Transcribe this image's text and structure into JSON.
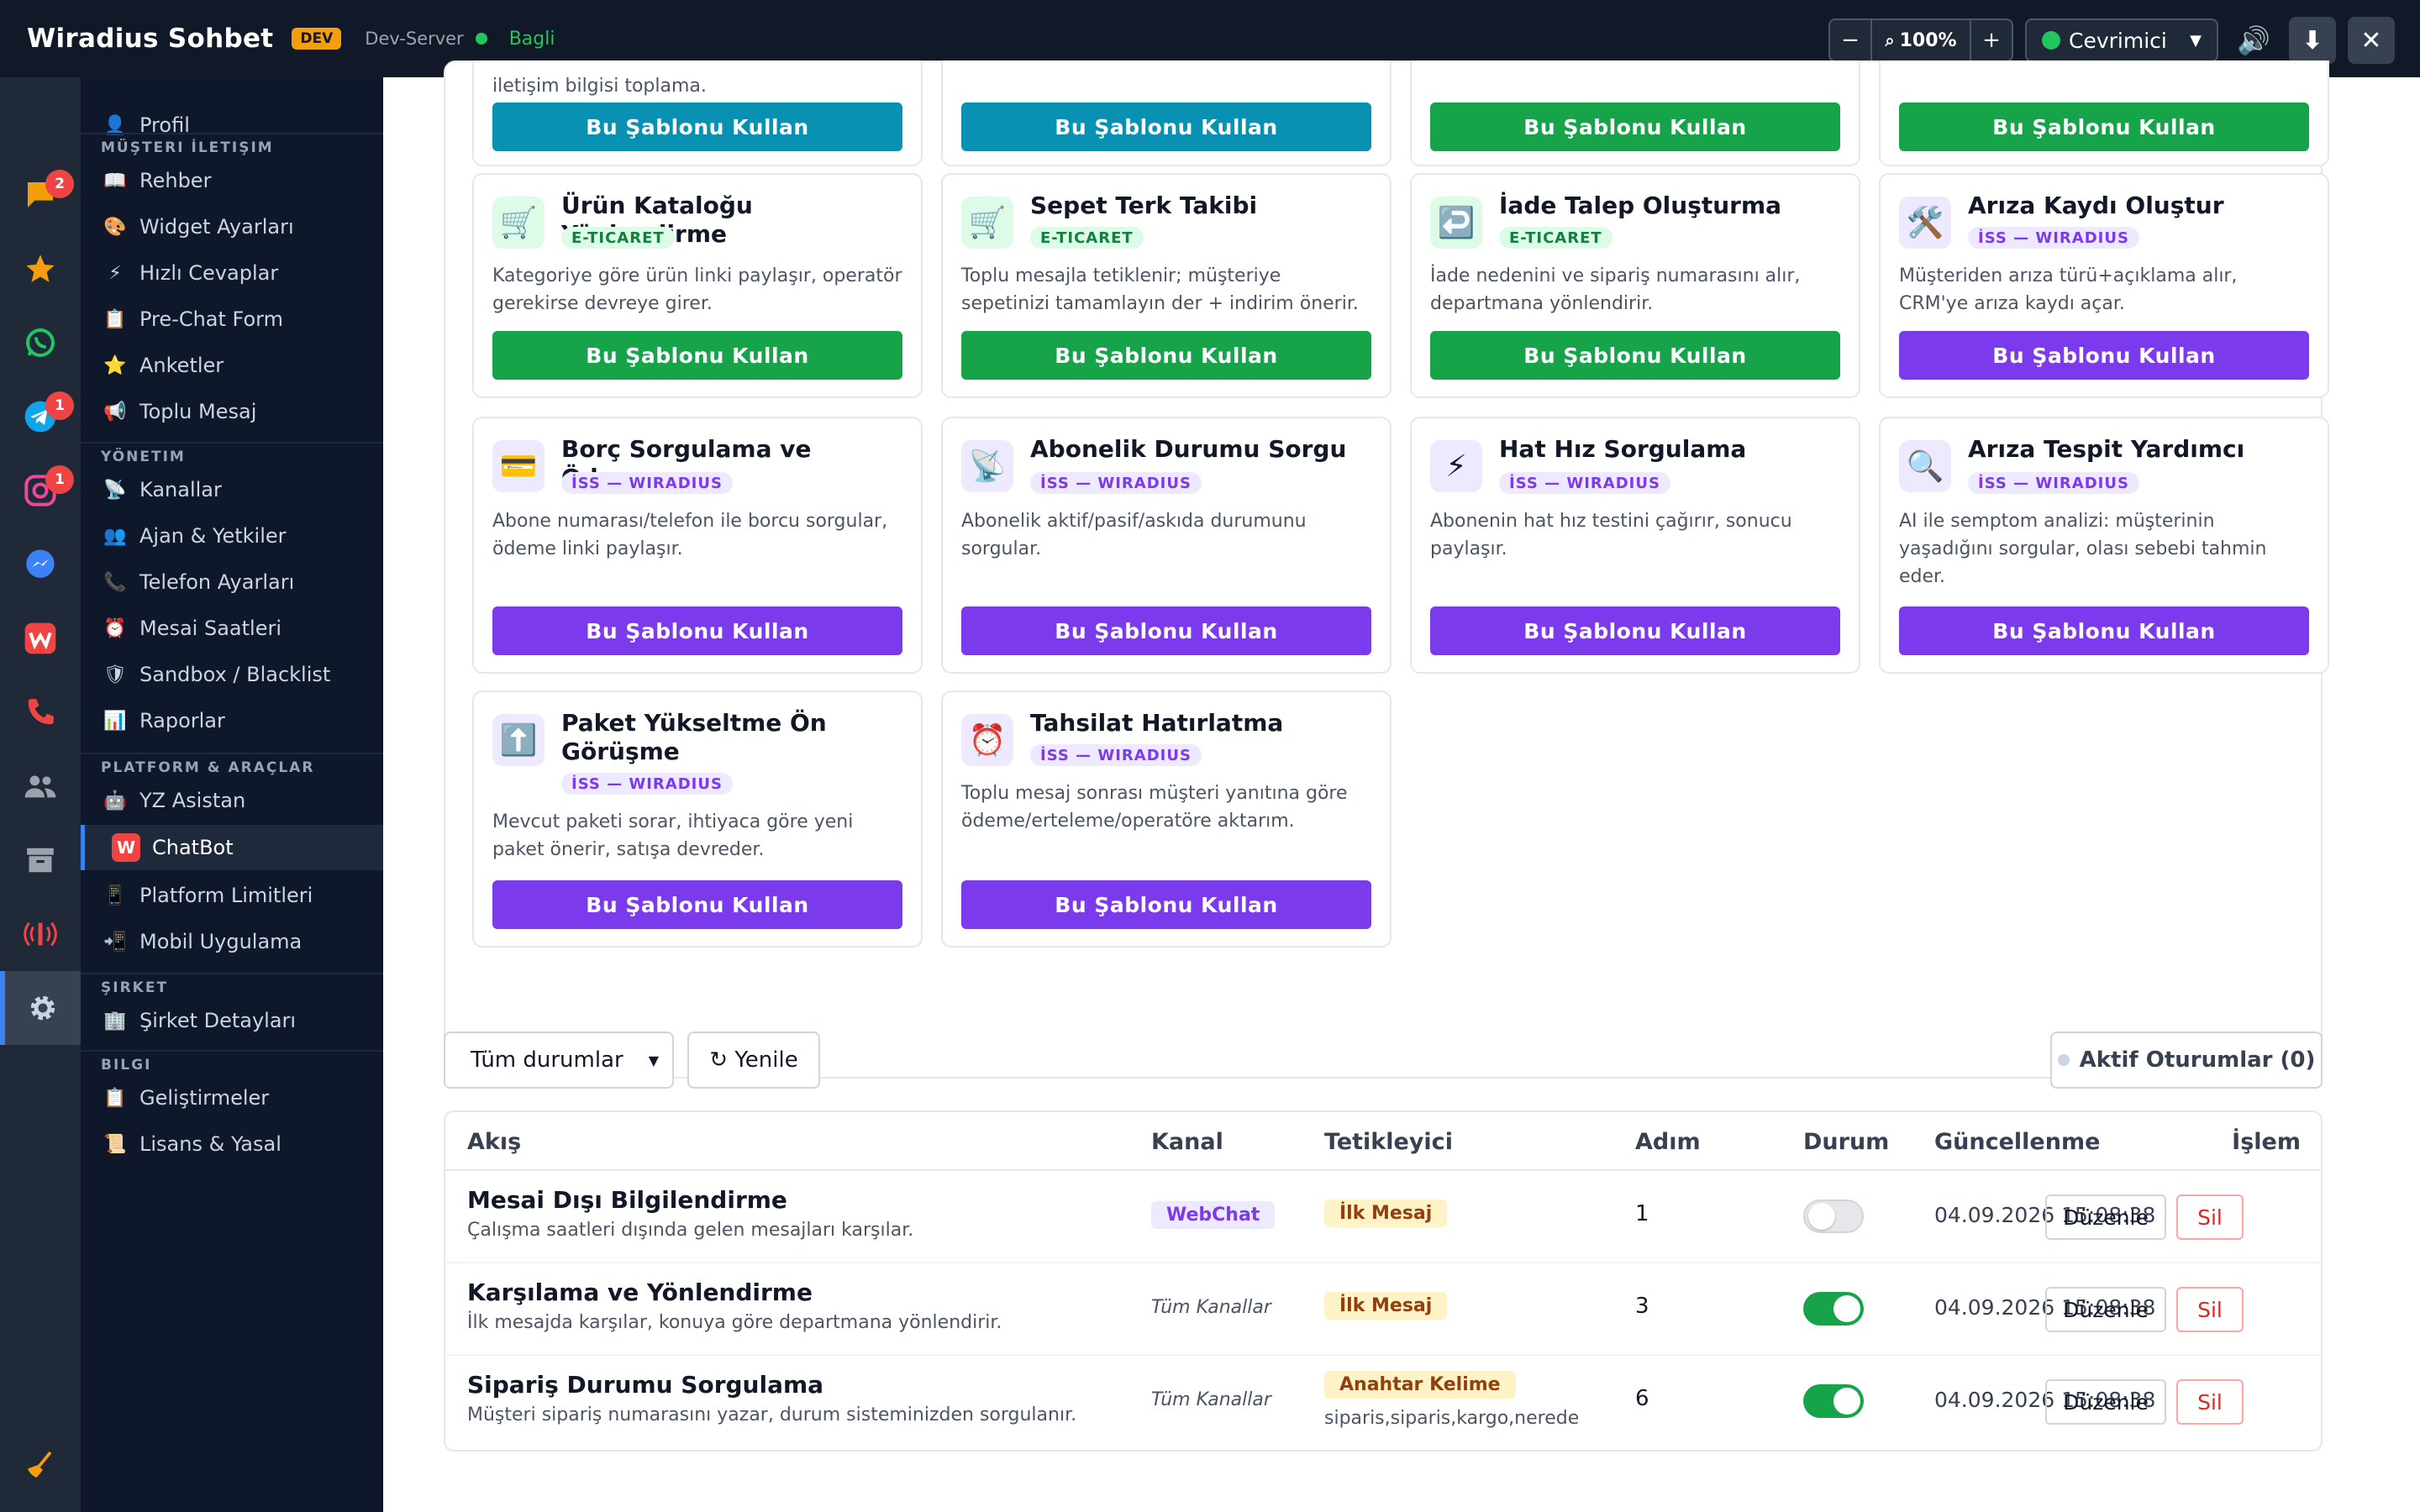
{
  "header": {
    "brand": "Wiradius Sohbet",
    "env_badge": "DEV",
    "server": "Dev-Server",
    "connection": "Bagli",
    "zoom_minus": "−",
    "zoom_value": "100%",
    "zoom_plus": "+",
    "status": "Cevrimici",
    "colors": {
      "accent": "#3b82f6",
      "online": "#22c55e",
      "dev": "#f59e0b"
    }
  },
  "rail": {
    "items": [
      {
        "icon": "chat-icon",
        "badge": "2"
      },
      {
        "icon": "star-icon",
        "badge": ""
      },
      {
        "icon": "whatsapp-icon",
        "badge": ""
      },
      {
        "icon": "telegram-icon",
        "badge": "1"
      },
      {
        "icon": "instagram-icon",
        "badge": "1"
      },
      {
        "icon": "messenger-icon",
        "badge": ""
      },
      {
        "icon": "wiradius-icon",
        "badge": ""
      },
      {
        "icon": "phone-icon",
        "badge": ""
      },
      {
        "icon": "users-icon",
        "badge": ""
      },
      {
        "icon": "archive-icon",
        "badge": ""
      },
      {
        "icon": "broadcast-icon",
        "badge": ""
      },
      {
        "icon": "gear-icon",
        "badge": ""
      },
      {
        "icon": "broom-icon",
        "badge": ""
      }
    ]
  },
  "sidebar": {
    "profile": "Profil",
    "sections": {
      "contact": "MÜŞTERI İLETIŞIM",
      "management": "YÖNETIM",
      "platform": "PLATFORM & ARAÇLAR",
      "company": "ŞIRKET",
      "info": "BILGI"
    },
    "items": {
      "rehber": "Rehber",
      "widget": "Widget Ayarları",
      "hizli": "Hızlı Cevaplar",
      "prechat": "Pre-Chat Form",
      "anketler": "Anketler",
      "toplu": "Toplu Mesaj",
      "kanallar": "Kanallar",
      "ajan": "Ajan & Yetkiler",
      "telefon": "Telefon Ayarları",
      "mesai": "Mesai Saatleri",
      "sandbox": "Sandbox / Blacklist",
      "raporlar": "Raporlar",
      "yz": "YZ Asistan",
      "chatbot": "ChatBot",
      "limitler": "Platform Limitleri",
      "mobil": "Mobil Uygulama",
      "sirket": "Şirket Detayları",
      "gelistirmeler": "Geliştirmeler",
      "lisans": "Lisans & Yasal"
    }
  },
  "templates": {
    "use_label": "Bu Şablonu Kullan",
    "top_desc": "iletişim bilgisi toplama.",
    "cards": [
      {
        "title": "Ürün Kataloğu Yönlendirme",
        "tag": "E-TICARET",
        "desc": "Kategoriye göre ürün linki paylaşır, operatör gerekirse devreye girer.",
        "icon": "🛒"
      },
      {
        "title": "Sepet Terk Takibi",
        "tag": "E-TICARET",
        "desc": "Toplu mesajla tetiklenir; müşteriye sepetinizi tamamlayın der + indirim önerir.",
        "icon": "🛒"
      },
      {
        "title": "İade Talep Oluşturma",
        "tag": "E-TICARET",
        "desc": "İade nedenini ve sipariş numarasını alır, departmana yönlendirir.",
        "icon": "↩️"
      },
      {
        "title": "Arıza Kaydı Oluştur",
        "tag": "İSS — WIRADIUS",
        "desc": "Müşteriden arıza türü+açıklama alır, CRM'ye arıza kaydı açar.",
        "icon": "🛠️"
      },
      {
        "title": "Borç Sorgulama ve Ödeme",
        "tag": "İSS — WIRADIUS",
        "desc": "Abone numarası/telefon ile borcu sorgular, ödeme linki paylaşır.",
        "icon": "💳"
      },
      {
        "title": "Abonelik Durumu Sorgu",
        "tag": "İSS — WIRADIUS",
        "desc": "Abonelik aktif/pasif/askıda durumunu sorgular.",
        "icon": "📡"
      },
      {
        "title": "Hat Hız Sorgulama",
        "tag": "İSS — WIRADIUS",
        "desc": "Abonenin hat hız testini çağırır, sonucu paylaşır.",
        "icon": "⚡"
      },
      {
        "title": "Arıza Tespit Yardımcı",
        "tag": "İSS — WIRADIUS",
        "desc": "AI ile semptom analizi: müşterinin yaşadığını sorgular, olası sebebi tahmin eder.",
        "icon": "🔍"
      },
      {
        "title": "Paket Yükseltme Ön Görüşme",
        "tag": "İSS — WIRADIUS",
        "desc": "Mevcut paketi sorar, ihtiyaca göre yeni paket önerir, satışa devreder.",
        "icon": "⬆️"
      },
      {
        "title": "Tahsilat Hatırlatma",
        "tag": "İSS — WIRADIUS",
        "desc": "Toplu mesaj sonrası müşteri yanıtına göre ödeme/erteleme/operatöre aktarım.",
        "icon": "⏰"
      }
    ]
  },
  "filters": {
    "status_select": "Tüm durumlar",
    "refresh": "↻ Yenile",
    "active_sessions": "Aktif Oturumlar (0)"
  },
  "table": {
    "headers": {
      "flow": "Akış",
      "channel": "Kanal",
      "trigger": "Tetikleyici",
      "step": "Adım",
      "status": "Durum",
      "updated": "Güncellenme",
      "action": "İşlem"
    },
    "edit_label": "Düzenle",
    "delete_label": "Sil",
    "rows": [
      {
        "name": "Mesai Dışı Bilgilendirme",
        "desc": "Çalışma saatleri dışında gelen mesajları karşılar.",
        "channel": "WebChat",
        "trigger": "İlk Mesaj",
        "keywords": "",
        "steps": "1",
        "active": false,
        "updated": "04.09.2026 15:08:38"
      },
      {
        "name": "Karşılama ve Yönlendirme",
        "desc": "İlk mesajda karşılar, konuya göre departmana yönlendirir.",
        "channel": "Tüm Kanallar",
        "trigger": "İlk Mesaj",
        "keywords": "",
        "steps": "3",
        "active": true,
        "updated": "04.09.2026 15:08:38"
      },
      {
        "name": "Sipariş Durumu Sorgulama",
        "desc": "Müşteri sipariş numarasını yazar, durum sisteminizden sorgulanır.",
        "channel": "Tüm Kanallar",
        "trigger": "Anahtar Kelime",
        "keywords": "siparis,siparis,kargo,nerede",
        "steps": "6",
        "active": true,
        "updated": "04.09.2026 15:08:38"
      }
    ]
  }
}
